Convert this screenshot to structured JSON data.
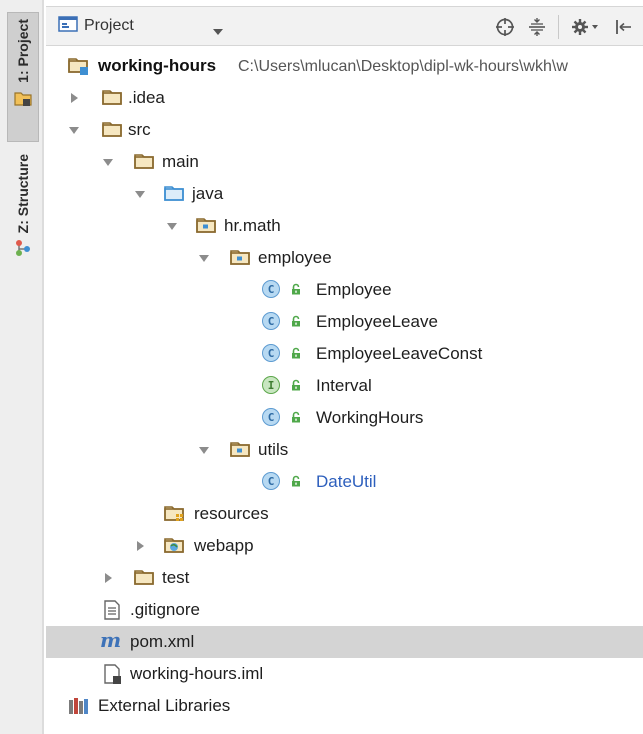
{
  "side_strip": {
    "tabs": [
      {
        "label": "1: Project",
        "icon": "project-folder-icon",
        "active": true
      },
      {
        "label": "Z: Structure",
        "icon": "structure-icon",
        "active": false
      }
    ]
  },
  "header": {
    "view_selector": "Project",
    "toolbar_icons": [
      "target-icon",
      "collapse-all-icon",
      "gear-icon",
      "hide-panel-icon"
    ]
  },
  "tree": {
    "root": {
      "name": "working-hours",
      "path": "C:\\Users\\mlucan\\Desktop\\dipl-wk-hours\\wkh\\w"
    },
    "idea": ".idea",
    "src": "src",
    "main": "main",
    "java": "java",
    "hrmath": "hr.math",
    "employee_pkg": "employee",
    "employee": "Employee",
    "employee_leave": "EmployeeLeave",
    "employee_leave_const": "EmployeeLeaveConst",
    "interval": "Interval",
    "working_hours": "WorkingHours",
    "utils_pkg": "utils",
    "date_util": "DateUtil",
    "resources": "resources",
    "webapp": "webapp",
    "test": "test",
    "gitignore": ".gitignore",
    "pom": "pom.xml",
    "iml": "working-hours.iml",
    "external_libraries": "External Libraries",
    "class_badge": "C",
    "interface_badge": "I",
    "maven_badge": "m"
  },
  "colors": {
    "folder": "#8a6a2f",
    "source_folder": "#3e8fd2",
    "selected_row": "#d4d4d4",
    "link_blue": "#2d5fbd",
    "lock_green": "#4fa84a"
  }
}
